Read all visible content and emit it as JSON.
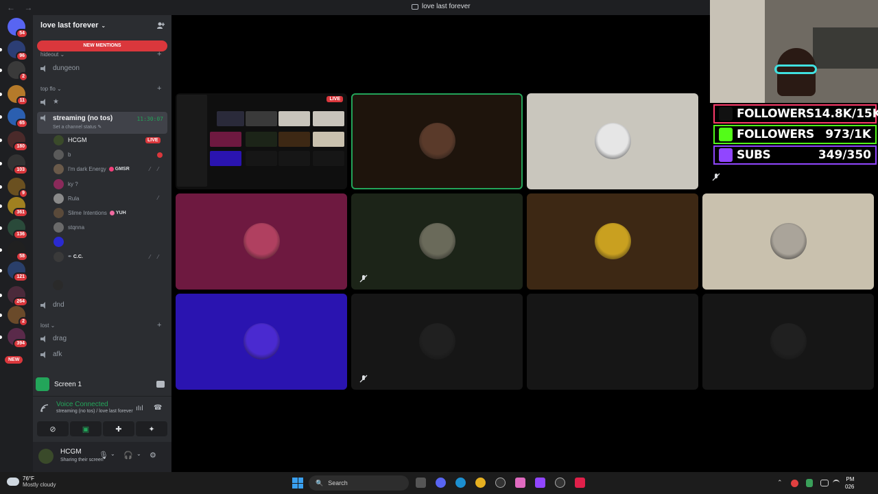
{
  "titlebar": {
    "back": "←",
    "forward": "→",
    "title": "love last forever"
  },
  "rail": {
    "servers": [
      {
        "badge": "54",
        "color": "#5865f2"
      },
      {
        "badge": "96",
        "color": "#2c3e75"
      },
      {
        "badge": "2",
        "color": "#3a3a3a"
      },
      {
        "badge": "11",
        "color": "#b57a2a"
      },
      {
        "badge": "65",
        "color": "#2b5fb0"
      },
      {
        "badge": "180",
        "color": "#4a2a2a"
      },
      {
        "badge": "103",
        "color": "#333"
      },
      {
        "badge": "9",
        "color": "#6a5020"
      },
      {
        "badge": "361",
        "color": "#a08020"
      },
      {
        "badge": "136",
        "color": "#2a4a3a"
      },
      {
        "badge": "58",
        "color": "#202020"
      },
      {
        "badge": "121",
        "color": "#2a3f6a"
      },
      {
        "badge": "264",
        "color": "#4a2a3a"
      },
      {
        "badge": "2",
        "color": "#6a4a2a"
      },
      {
        "badge": "394",
        "color": "#5a2a4a"
      }
    ],
    "new_label": "NEW"
  },
  "sidebar": {
    "guild_name": "love last forever",
    "chevron": "⌄",
    "new_mentions": "NEW MENTIONS",
    "categories": {
      "hideout": "hideout ⌄",
      "top_flo": "top flo ⌄",
      "lost": "lost ⌄"
    },
    "plus": "+",
    "channels": {
      "dungeon": "dungeon",
      "star": "★",
      "streaming": "streaming (no tos)",
      "streaming_status": "Set a channel status ✎",
      "timer": "11:30:07",
      "dnd": "dnd",
      "drag": "drag",
      "afk": "afk"
    },
    "users": [
      {
        "name": "HCGM",
        "live": "LIVE",
        "color": "#3a4a2a"
      },
      {
        "name": "b",
        "color": "#5a5a5a"
      },
      {
        "name": "I'm dark Energy",
        "tag": "GMSR",
        "tag_color": "#f23f7a",
        "color": "#6a5a4a"
      },
      {
        "name": "ky ?",
        "color": "#8a2a5a"
      },
      {
        "name": "Rula",
        "color": "#8a8a8a"
      },
      {
        "name": "Slime Intentions",
        "tag": "YUH",
        "tag_color": "#f06aa0",
        "color": "#5a4a3a"
      },
      {
        "name": "stqnna",
        "color": "#6a6a6a"
      },
      {
        "name": "",
        "color": "#2a2ad0"
      },
      {
        "name": "C.C.",
        "tag_icon": "✒",
        "color": "#3a3a3a"
      },
      {
        "name": "",
        "color": "#2a2a2a"
      }
    ]
  },
  "screen_panel": {
    "label": "Screen 1"
  },
  "voice": {
    "status": "Voice Connected",
    "subtitle": "streaming (no tos) / love last forever",
    "wave": "ıIıl",
    "hang": "☎"
  },
  "voice_buttons": [
    "⊘",
    "▣",
    "✚",
    "✦"
  ],
  "userbar": {
    "name": "HCGM",
    "sub": "Sharing their screen",
    "mic": "🎙",
    "headset": "🎧",
    "gear": "⚙",
    "chev": "⌄"
  },
  "stage": {
    "live": "LIVE",
    "tiles": [
      {
        "bg": "#0f0f0f",
        "face": "",
        "kind": "screen"
      },
      {
        "bg": "#1e140c",
        "face": "#5a3a2a",
        "speaking": true
      },
      {
        "bg": "#c9c6bd",
        "face": "#e6e6e6"
      },
      {
        "bg": "#6e1940",
        "face": "#b04060"
      },
      {
        "bg": "#1c2418",
        "face": "#6a6a5a",
        "muted": true
      },
      {
        "bg": "#3d2814",
        "face": "#c9a020"
      },
      {
        "bg": "#c9c1ae",
        "face": "#aaa49a"
      },
      {
        "bg": "#2a14b0",
        "face": "#4a2ad0"
      },
      {
        "bg": "#161616",
        "face": "#202020",
        "muted": true
      },
      {
        "bg": "#161616",
        "face": ""
      },
      {
        "bg": "#161616",
        "face": "#202020"
      }
    ]
  },
  "overlay": {
    "rows": [
      {
        "label": "FOLLOWERS",
        "value": "14.8K/15K",
        "border": "#ff3b6b",
        "icon": "#111"
      },
      {
        "label": "FOLLOWERS",
        "value": "973/1K",
        "border": "#53fc18",
        "icon": "#53fc18"
      },
      {
        "label": "SUBS",
        "value": "349/350",
        "border": "#9146ff",
        "icon": "#9146ff"
      }
    ]
  },
  "taskbar": {
    "temp": "76°F",
    "condition": "Mostly cloudy",
    "search": "Search",
    "search_icon": "🔍",
    "tray_up": "⌃",
    "time": "PM",
    "date": "026"
  }
}
